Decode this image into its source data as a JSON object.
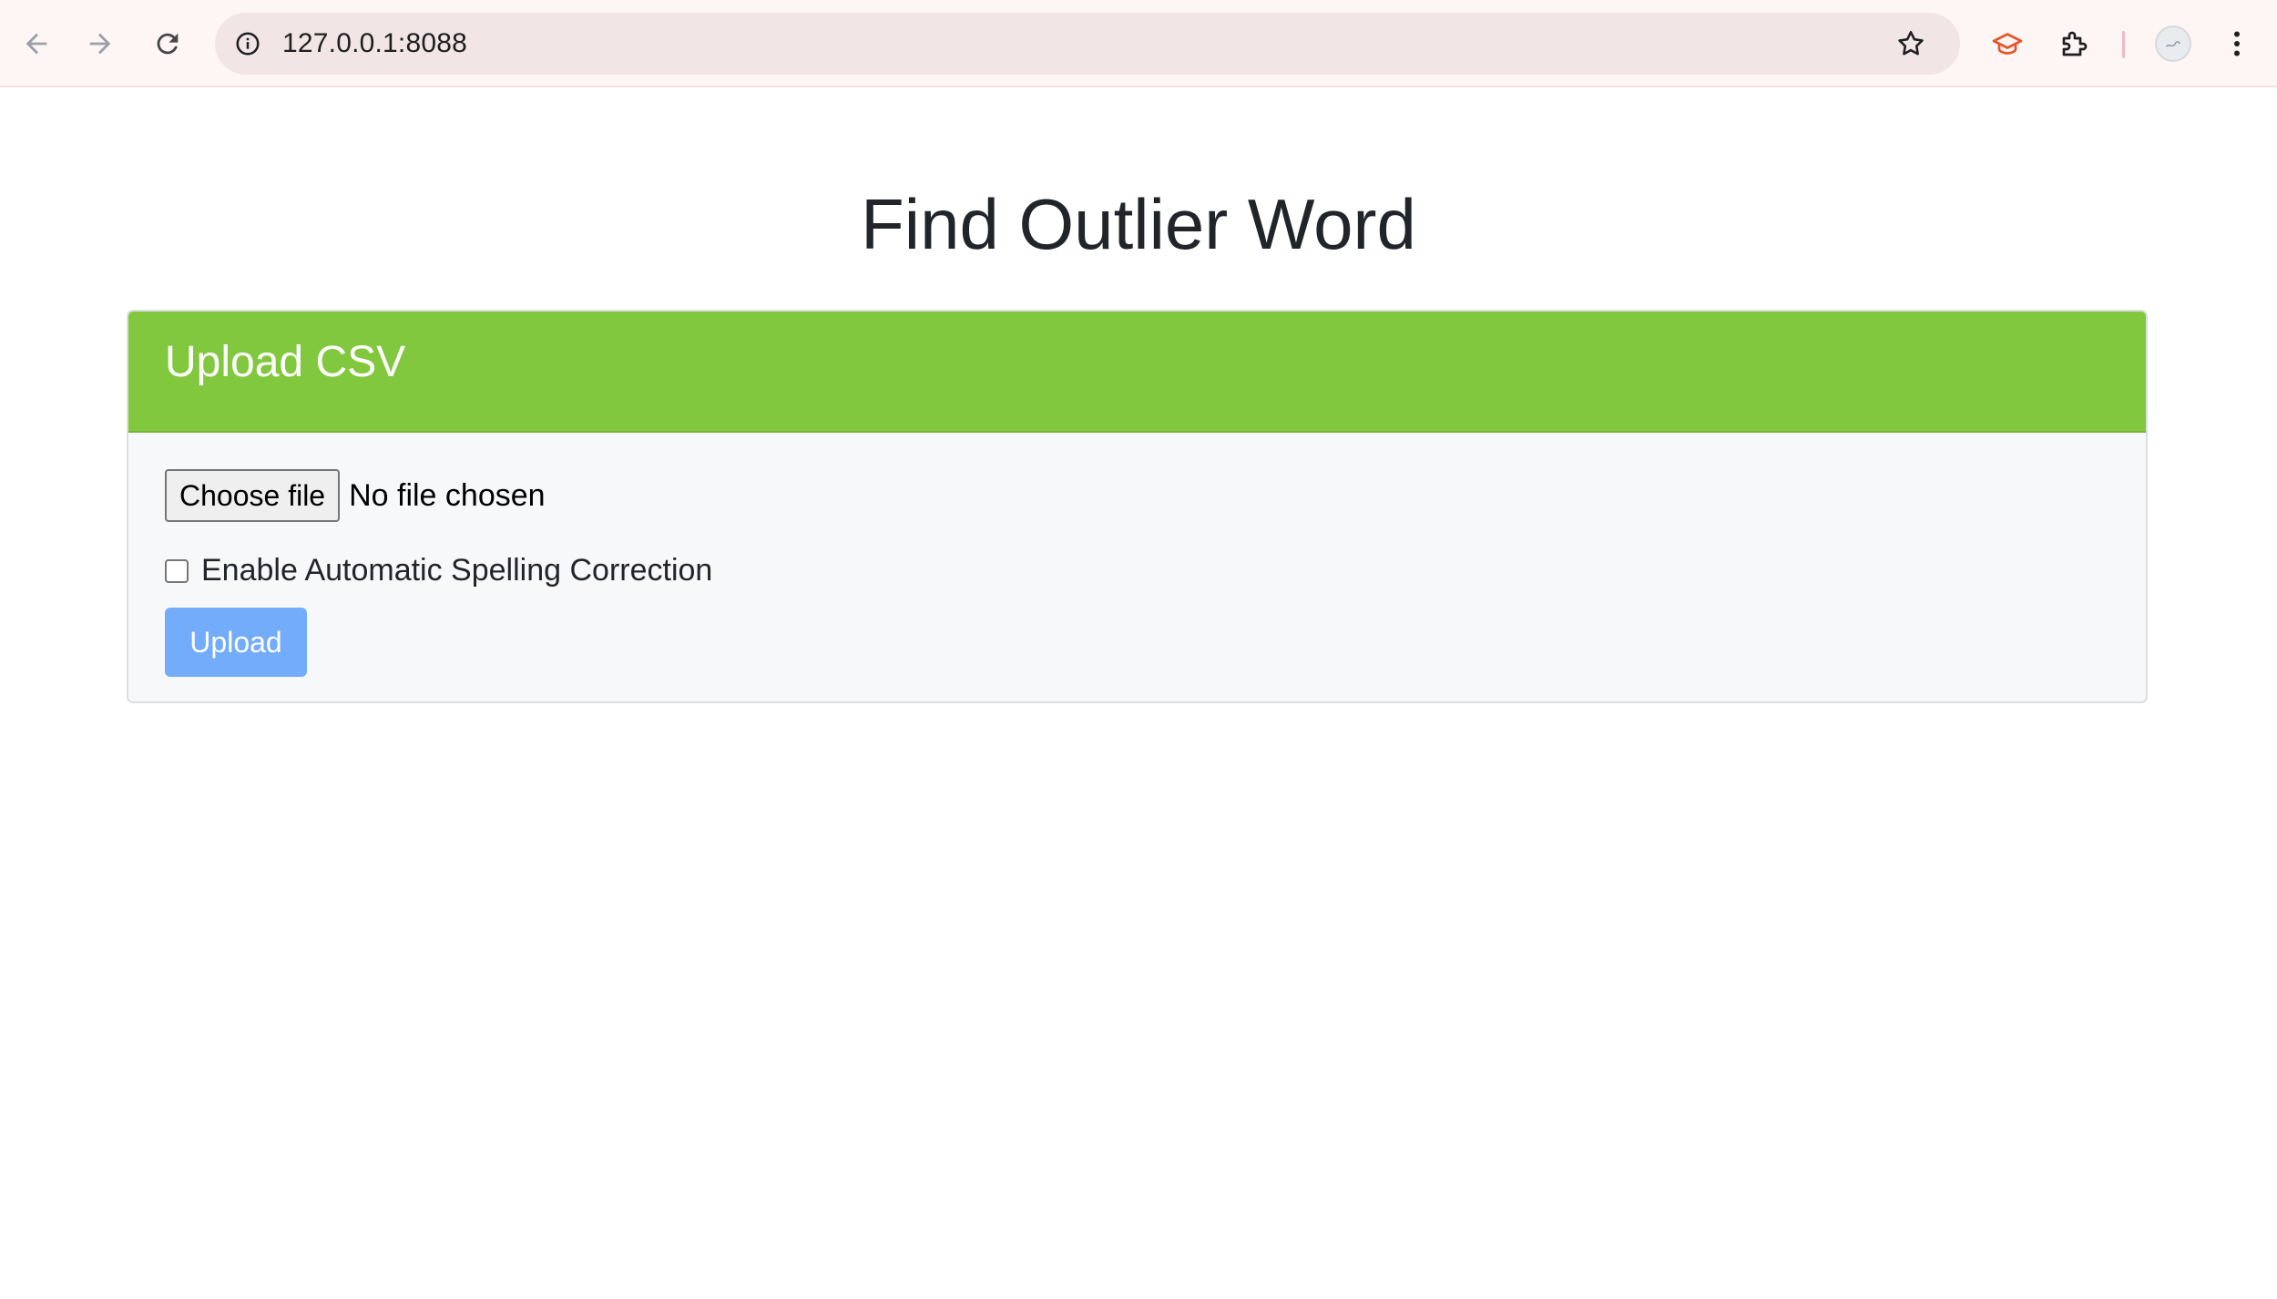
{
  "browser": {
    "url": "127.0.0.1:8088",
    "icons": {
      "back": "back-arrow-icon",
      "forward": "forward-arrow-icon",
      "reload": "reload-icon",
      "site_info": "info-icon",
      "bookmark": "star-icon",
      "extension_cap": "graduation-cap-icon",
      "extensions": "puzzle-icon",
      "profile": "avatar",
      "menu": "kebab-menu-icon"
    },
    "colors": {
      "chrome_bg": "#fdf6f5",
      "omnibox_bg": "#f1e5e6",
      "extension_accent": "#e8542a"
    }
  },
  "page": {
    "title": "Find Outlier Word"
  },
  "upload_card": {
    "header": "Upload CSV",
    "file_button_label": "Choose file",
    "file_status": "No file chosen",
    "spelling_checkbox_label": "Enable Automatic Spelling Correction",
    "spelling_checkbox_checked": false,
    "submit_label": "Upload",
    "colors": {
      "header_bg": "#82c83e",
      "submit_bg": "#72acfa",
      "body_bg": "#f7f8fa"
    }
  }
}
